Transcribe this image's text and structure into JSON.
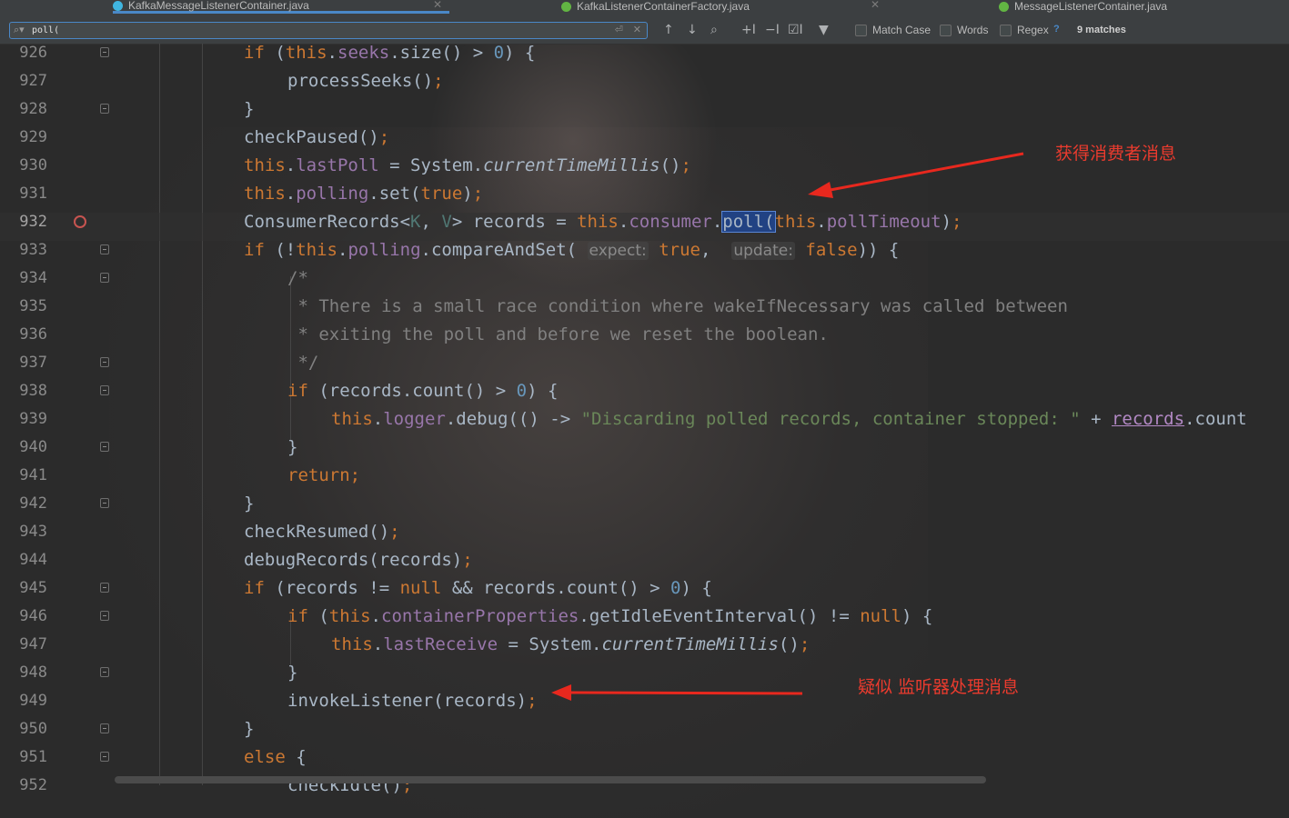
{
  "tabs": [
    {
      "label": "KafkaMessageListenerContainer.java",
      "active": true,
      "icon_color": "#40b6e0"
    },
    {
      "label": "KafkaListenerContainerFactory.java",
      "active": false,
      "icon_color": "#62b543"
    },
    {
      "label": "MessageListenerContainer.java",
      "active": false,
      "icon_color": "#62b543"
    }
  ],
  "search": {
    "query": "poll(",
    "options": {
      "match_case": {
        "label": "Match Case",
        "checked": false
      },
      "words": {
        "label": "Words",
        "checked": false
      },
      "regex": {
        "label": "Regex",
        "checked": false
      }
    },
    "help": "?",
    "matches": "9 matches"
  },
  "icons": {
    "search": "search-icon",
    "newline": "newline-icon",
    "clear": "close-icon",
    "prev": "arrow-up-icon",
    "next": "arrow-down-icon",
    "find_all": "find-all-icon",
    "add_selection": "add-occurrence-icon",
    "remove_selection": "remove-occurrence-icon",
    "select_all": "select-all-occurrences-icon",
    "filter": "filter-icon"
  },
  "editor": {
    "current_line": 932,
    "breakpoint_line": 932,
    "lines": [
      {
        "n": "926",
        "code": "if (this.seeks.size() > 0) {"
      },
      {
        "n": "927",
        "code": "processSeeks();"
      },
      {
        "n": "928",
        "code": "}"
      },
      {
        "n": "929",
        "code": "checkPaused();"
      },
      {
        "n": "930",
        "code": "this.lastPoll = System.currentTimeMillis();"
      },
      {
        "n": "931",
        "code": "this.polling.set(true);"
      },
      {
        "n": "932",
        "code": "ConsumerRecords<K, V> records = this.consumer.poll(this.pollTimeout);"
      },
      {
        "n": "933",
        "code": "if (!this.polling.compareAndSet( expect: true,  update: false)) {"
      },
      {
        "n": "934",
        "code": "/*"
      },
      {
        "n": "935",
        "code": " * There is a small race condition where wakeIfNecessary was called between"
      },
      {
        "n": "936",
        "code": " * exiting the poll and before we reset the boolean."
      },
      {
        "n": "937",
        "code": " */"
      },
      {
        "n": "938",
        "code": "if (records.count() > 0) {"
      },
      {
        "n": "939",
        "code": "this.logger.debug(() -> \"Discarding polled records, container stopped: \" + records.count"
      },
      {
        "n": "940",
        "code": "}"
      },
      {
        "n": "941",
        "code": "return;"
      },
      {
        "n": "942",
        "code": "}"
      },
      {
        "n": "943",
        "code": "checkResumed();"
      },
      {
        "n": "944",
        "code": "debugRecords(records);"
      },
      {
        "n": "945",
        "code": "if (records != null && records.count() > 0) {"
      },
      {
        "n": "946",
        "code": "if (this.containerProperties.getIdleEventInterval() != null) {"
      },
      {
        "n": "947",
        "code": "this.lastReceive = System.currentTimeMillis();"
      },
      {
        "n": "948",
        "code": "}"
      },
      {
        "n": "949",
        "code": "invokeListener(records);"
      },
      {
        "n": "950",
        "code": "}"
      },
      {
        "n": "951",
        "code": "else {"
      },
      {
        "n": "952",
        "code": "checkIdle();"
      }
    ]
  },
  "annotations": [
    {
      "text": "获得消费者消息",
      "color": "#ea3b2e"
    },
    {
      "text": "疑似 监听器处理消息",
      "color": "#ea3b2e"
    }
  ]
}
